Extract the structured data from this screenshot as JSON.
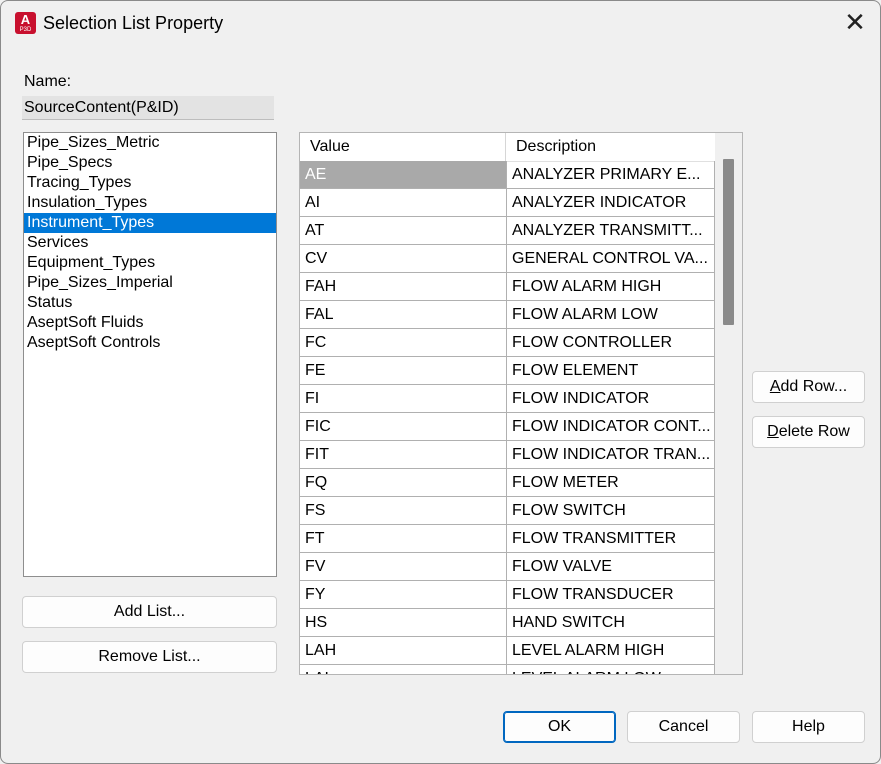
{
  "window": {
    "title": "Selection List Property",
    "app_icon_letter": "A",
    "app_icon_sub": "P3D",
    "close_glyph": "✕"
  },
  "name": {
    "label": "Name:",
    "value": "SourceContent(P&ID)"
  },
  "lists": {
    "items": [
      "Pipe_Sizes_Metric",
      "Pipe_Specs",
      "Tracing_Types",
      "Insulation_Types",
      "Instrument_Types",
      "Services",
      "Equipment_Types",
      "Pipe_Sizes_Imperial",
      "Status",
      "AseptSoft Fluids",
      "AseptSoft Controls"
    ],
    "selected": "Instrument_Types"
  },
  "buttons": {
    "add_list": "Add List...",
    "remove_list": "Remove List...",
    "add_row": "Add Row...",
    "delete_row": "Delete Row",
    "ok": "OK",
    "cancel": "Cancel",
    "help": "Help"
  },
  "grid": {
    "columns": [
      "Value",
      "Description"
    ],
    "rows": [
      [
        "AE",
        "ANALYZER PRIMARY E..."
      ],
      [
        "AI",
        "ANALYZER INDICATOR"
      ],
      [
        "AT",
        "ANALYZER TRANSMITT..."
      ],
      [
        "CV",
        "GENERAL CONTROL VA..."
      ],
      [
        "FAH",
        "FLOW ALARM HIGH"
      ],
      [
        "FAL",
        "FLOW ALARM LOW"
      ],
      [
        "FC",
        "FLOW CONTROLLER"
      ],
      [
        "FE",
        "FLOW ELEMENT"
      ],
      [
        "FI",
        "FLOW INDICATOR"
      ],
      [
        "FIC",
        "FLOW INDICATOR CONT..."
      ],
      [
        "FIT",
        "FLOW INDICATOR TRAN..."
      ],
      [
        "FQ",
        "FLOW METER"
      ],
      [
        "FS",
        "FLOW SWITCH"
      ],
      [
        "FT",
        "FLOW TRANSMITTER"
      ],
      [
        "FV",
        "FLOW VALVE"
      ],
      [
        "FY",
        "FLOW TRANSDUCER"
      ],
      [
        "HS",
        "HAND SWITCH"
      ],
      [
        "LAH",
        "LEVEL ALARM HIGH"
      ],
      [
        "LAL",
        "LEVEL ALARM LOW"
      ]
    ],
    "selected_row": 0
  }
}
